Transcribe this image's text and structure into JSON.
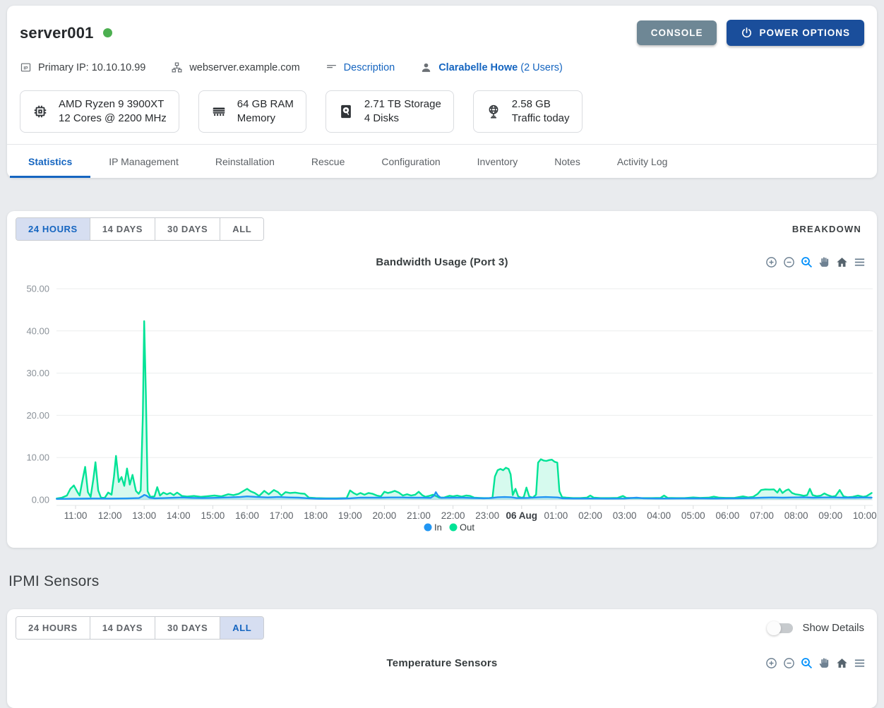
{
  "header": {
    "title": "server001",
    "status": "online",
    "console_label": "CONSOLE",
    "power_label": "POWER OPTIONS",
    "info": {
      "primary_ip": "Primary IP: 10.10.10.99",
      "hostname": "webserver.example.com",
      "description_link": "Description",
      "owner": "Clarabelle Howe",
      "owner_users": "(2 Users)"
    },
    "specs": [
      {
        "icon": "cpu-icon",
        "line1": "AMD Ryzen 9 3900XT",
        "line2": "12 Cores @ 2200 MHz"
      },
      {
        "icon": "ram-icon",
        "line1": "64 GB RAM",
        "line2": "Memory"
      },
      {
        "icon": "disk-icon",
        "line1": "2.71 TB Storage",
        "line2": "4 Disks"
      },
      {
        "icon": "traffic-icon",
        "line1": "2.58 GB",
        "line2": "Traffic today"
      }
    ],
    "tabs": [
      "Statistics",
      "IP Management",
      "Reinstallation",
      "Rescue",
      "Configuration",
      "Inventory",
      "Notes",
      "Activity Log"
    ],
    "active_tab": "Statistics"
  },
  "time_ranges": [
    "24 HOURS",
    "14 DAYS",
    "30 DAYS",
    "ALL"
  ],
  "bandwidth_section": {
    "active_range": "24 HOURS",
    "breakdown_label": "BREAKDOWN",
    "toolbar_icons": [
      "zoom-in-icon",
      "zoom-out-icon",
      "selection-zoom-icon",
      "pan-icon",
      "home-icon",
      "menu-icon"
    ]
  },
  "ipmi": {
    "heading": "IPMI Sensors",
    "active_range": "ALL",
    "show_details_label": "Show Details",
    "chart_title": "Temperature Sensors",
    "toolbar_icons": [
      "zoom-in-icon",
      "zoom-out-icon",
      "selection-zoom-icon",
      "pan-icon",
      "home-icon",
      "menu-icon"
    ]
  },
  "colors": {
    "accent_blue": "#1565c0",
    "power_button": "#1a4e9b",
    "console_button": "#6e8795",
    "status_green": "#4caf50",
    "series_in": "#2196F3",
    "series_out": "#00E396",
    "toolbar_gray": "#6E8192",
    "selection_zoom_blue": "#008FFB"
  },
  "chart_data": {
    "type": "area",
    "title": "Bandwidth Usage (Port 3)",
    "ylim": [
      0,
      50
    ],
    "y_ticks": [
      "0.00",
      "10.00",
      "20.00",
      "30.00",
      "40.00",
      "50.00"
    ],
    "x_tick_labels": [
      "11:00",
      "12:00",
      "13:00",
      "14:00",
      "15:00",
      "16:00",
      "17:00",
      "18:00",
      "19:00",
      "20:00",
      "21:00",
      "22:00",
      "23:00",
      "06 Aug",
      "01:00",
      "02:00",
      "03:00",
      "04:00",
      "05:00",
      "06:00",
      "07:00",
      "08:00",
      "09:00",
      "10:00"
    ],
    "x_range": [
      10.45,
      34.2
    ],
    "grid": "horizontal",
    "legend_position": "bottom",
    "legend": [
      "In",
      "Out"
    ],
    "series": [
      {
        "name": "In",
        "color": "#2196F3",
        "points": [
          [
            10.45,
            0.2
          ],
          [
            11.0,
            0.25
          ],
          [
            11.5,
            0.3
          ],
          [
            12.0,
            0.28
          ],
          [
            12.5,
            0.32
          ],
          [
            12.85,
            0.4
          ],
          [
            12.96,
            0.9
          ],
          [
            13.0,
            1.15
          ],
          [
            13.06,
            1.0
          ],
          [
            13.15,
            0.5
          ],
          [
            13.3,
            0.35
          ],
          [
            13.6,
            0.4
          ],
          [
            13.9,
            0.5
          ],
          [
            14.1,
            0.55
          ],
          [
            14.4,
            0.45
          ],
          [
            14.7,
            0.4
          ],
          [
            15.0,
            0.45
          ],
          [
            15.4,
            0.55
          ],
          [
            15.8,
            0.65
          ],
          [
            16.0,
            0.8
          ],
          [
            16.3,
            0.65
          ],
          [
            16.6,
            0.55
          ],
          [
            16.9,
            0.65
          ],
          [
            17.2,
            0.55
          ],
          [
            17.5,
            0.5
          ],
          [
            17.8,
            0.35
          ],
          [
            18.1,
            0.25
          ],
          [
            18.6,
            0.25
          ],
          [
            19.0,
            0.35
          ],
          [
            19.3,
            0.5
          ],
          [
            19.6,
            0.5
          ],
          [
            19.9,
            0.5
          ],
          [
            20.2,
            0.55
          ],
          [
            20.5,
            0.55
          ],
          [
            20.8,
            0.5
          ],
          [
            21.1,
            0.5
          ],
          [
            21.35,
            0.45
          ],
          [
            21.45,
            1.0
          ],
          [
            21.5,
            1.8
          ],
          [
            21.56,
            1.0
          ],
          [
            21.65,
            0.45
          ],
          [
            22.0,
            0.5
          ],
          [
            22.3,
            0.5
          ],
          [
            22.6,
            0.4
          ],
          [
            22.9,
            0.35
          ],
          [
            23.1,
            0.4
          ],
          [
            23.3,
            0.6
          ],
          [
            23.5,
            0.65
          ],
          [
            23.7,
            0.6
          ],
          [
            23.85,
            0.4
          ],
          [
            24.0,
            0.4
          ],
          [
            24.2,
            0.45
          ],
          [
            24.5,
            0.6
          ],
          [
            24.7,
            0.65
          ],
          [
            24.9,
            0.6
          ],
          [
            25.05,
            0.55
          ],
          [
            25.2,
            0.35
          ],
          [
            25.5,
            0.3
          ],
          [
            25.8,
            0.3
          ],
          [
            26.1,
            0.3
          ],
          [
            26.5,
            0.28
          ],
          [
            27.0,
            0.3
          ],
          [
            27.35,
            0.5
          ],
          [
            27.55,
            0.35
          ],
          [
            27.9,
            0.3
          ],
          [
            28.3,
            0.3
          ],
          [
            28.7,
            0.32
          ],
          [
            29.1,
            0.35
          ],
          [
            29.5,
            0.3
          ],
          [
            29.9,
            0.32
          ],
          [
            30.3,
            0.35
          ],
          [
            30.7,
            0.4
          ],
          [
            31.0,
            0.5
          ],
          [
            31.3,
            0.55
          ],
          [
            31.6,
            0.5
          ],
          [
            31.9,
            0.55
          ],
          [
            32.2,
            0.6
          ],
          [
            32.5,
            0.5
          ],
          [
            32.8,
            0.55
          ],
          [
            33.1,
            0.55
          ],
          [
            33.4,
            0.5
          ],
          [
            33.7,
            0.5
          ],
          [
            34.0,
            0.55
          ],
          [
            34.2,
            0.5
          ]
        ]
      },
      {
        "name": "Out",
        "color": "#00E396",
        "points": [
          [
            10.45,
            0.3
          ],
          [
            10.6,
            0.5
          ],
          [
            10.75,
            1.0
          ],
          [
            10.85,
            2.6
          ],
          [
            10.95,
            3.4
          ],
          [
            11.05,
            1.9
          ],
          [
            11.12,
            1.0
          ],
          [
            11.2,
            4.5
          ],
          [
            11.28,
            7.8
          ],
          [
            11.36,
            1.8
          ],
          [
            11.44,
            0.7
          ],
          [
            11.52,
            5.0
          ],
          [
            11.58,
            8.9
          ],
          [
            11.66,
            2.2
          ],
          [
            11.74,
            0.5
          ],
          [
            11.85,
            0.45
          ],
          [
            11.95,
            1.7
          ],
          [
            12.05,
            1.2
          ],
          [
            12.12,
            5.5
          ],
          [
            12.18,
            10.4
          ],
          [
            12.26,
            4.2
          ],
          [
            12.34,
            5.4
          ],
          [
            12.42,
            3.3
          ],
          [
            12.5,
            7.4
          ],
          [
            12.58,
            3.6
          ],
          [
            12.66,
            5.9
          ],
          [
            12.76,
            2.1
          ],
          [
            12.84,
            1.4
          ],
          [
            12.9,
            2.2
          ],
          [
            12.96,
            20.0
          ],
          [
            13.0,
            42.3
          ],
          [
            13.05,
            25.0
          ],
          [
            13.1,
            2.0
          ],
          [
            13.18,
            0.7
          ],
          [
            13.3,
            0.8
          ],
          [
            13.38,
            3.0
          ],
          [
            13.46,
            1.0
          ],
          [
            13.56,
            1.7
          ],
          [
            13.66,
            1.3
          ],
          [
            13.76,
            1.6
          ],
          [
            13.86,
            1.1
          ],
          [
            13.96,
            1.7
          ],
          [
            14.1,
            0.9
          ],
          [
            14.25,
            0.75
          ],
          [
            14.45,
            0.9
          ],
          [
            14.65,
            0.7
          ],
          [
            14.85,
            0.85
          ],
          [
            15.05,
            1.0
          ],
          [
            15.25,
            0.8
          ],
          [
            15.45,
            1.3
          ],
          [
            15.6,
            1.1
          ],
          [
            15.75,
            1.4
          ],
          [
            15.9,
            2.1
          ],
          [
            16.0,
            2.6
          ],
          [
            16.1,
            2.0
          ],
          [
            16.22,
            1.6
          ],
          [
            16.35,
            0.9
          ],
          [
            16.5,
            2.1
          ],
          [
            16.63,
            1.3
          ],
          [
            16.78,
            2.3
          ],
          [
            16.9,
            1.8
          ],
          [
            17.0,
            1.0
          ],
          [
            17.12,
            1.8
          ],
          [
            17.25,
            1.6
          ],
          [
            17.4,
            1.7
          ],
          [
            17.55,
            1.5
          ],
          [
            17.68,
            1.4
          ],
          [
            17.8,
            0.5
          ],
          [
            18.0,
            0.4
          ],
          [
            18.3,
            0.35
          ],
          [
            18.6,
            0.35
          ],
          [
            18.9,
            0.4
          ],
          [
            19.0,
            2.2
          ],
          [
            19.1,
            1.6
          ],
          [
            19.2,
            1.2
          ],
          [
            19.3,
            1.6
          ],
          [
            19.42,
            1.2
          ],
          [
            19.54,
            1.6
          ],
          [
            19.66,
            1.4
          ],
          [
            19.78,
            1.0
          ],
          [
            19.9,
            0.8
          ],
          [
            20.0,
            1.9
          ],
          [
            20.1,
            1.6
          ],
          [
            20.2,
            1.8
          ],
          [
            20.3,
            2.1
          ],
          [
            20.42,
            1.7
          ],
          [
            20.54,
            1.0
          ],
          [
            20.66,
            1.3
          ],
          [
            20.78,
            1.0
          ],
          [
            20.9,
            1.2
          ],
          [
            21.0,
            1.9
          ],
          [
            21.1,
            1.1
          ],
          [
            21.2,
            0.7
          ],
          [
            21.3,
            0.9
          ],
          [
            21.42,
            1.2
          ],
          [
            21.5,
            0.9
          ],
          [
            21.6,
            0.5
          ],
          [
            21.75,
            0.55
          ],
          [
            21.9,
            0.95
          ],
          [
            22.0,
            0.8
          ],
          [
            22.12,
            1.0
          ],
          [
            22.25,
            0.75
          ],
          [
            22.38,
            1.0
          ],
          [
            22.5,
            0.9
          ],
          [
            22.62,
            0.5
          ],
          [
            22.75,
            0.45
          ],
          [
            22.9,
            0.4
          ],
          [
            23.05,
            0.4
          ],
          [
            23.15,
            0.5
          ],
          [
            23.22,
            5.5
          ],
          [
            23.3,
            7.0
          ],
          [
            23.38,
            7.3
          ],
          [
            23.46,
            7.0
          ],
          [
            23.54,
            7.6
          ],
          [
            23.62,
            7.3
          ],
          [
            23.68,
            6.0
          ],
          [
            23.74,
            1.1
          ],
          [
            23.82,
            2.6
          ],
          [
            23.9,
            0.8
          ],
          [
            23.98,
            0.5
          ],
          [
            24.06,
            0.6
          ],
          [
            24.14,
            2.9
          ],
          [
            24.22,
            0.8
          ],
          [
            24.32,
            0.5
          ],
          [
            24.42,
            1.2
          ],
          [
            24.48,
            8.8
          ],
          [
            24.56,
            9.6
          ],
          [
            24.64,
            9.3
          ],
          [
            24.72,
            9.2
          ],
          [
            24.8,
            9.4
          ],
          [
            24.88,
            9.5
          ],
          [
            24.96,
            9.0
          ],
          [
            25.04,
            8.8
          ],
          [
            25.1,
            2.0
          ],
          [
            25.18,
            0.6
          ],
          [
            25.3,
            0.5
          ],
          [
            25.5,
            0.4
          ],
          [
            25.7,
            0.4
          ],
          [
            25.9,
            0.5
          ],
          [
            26.0,
            1.0
          ],
          [
            26.1,
            0.5
          ],
          [
            26.3,
            0.4
          ],
          [
            26.55,
            0.4
          ],
          [
            26.8,
            0.45
          ],
          [
            26.95,
            0.9
          ],
          [
            27.05,
            0.45
          ],
          [
            27.3,
            0.4
          ],
          [
            27.55,
            0.4
          ],
          [
            27.8,
            0.4
          ],
          [
            28.05,
            0.45
          ],
          [
            28.15,
            1.0
          ],
          [
            28.25,
            0.45
          ],
          [
            28.5,
            0.4
          ],
          [
            28.75,
            0.4
          ],
          [
            29.0,
            0.55
          ],
          [
            29.2,
            0.45
          ],
          [
            29.45,
            0.5
          ],
          [
            29.6,
            0.75
          ],
          [
            29.75,
            0.5
          ],
          [
            29.95,
            0.45
          ],
          [
            30.2,
            0.45
          ],
          [
            30.45,
            0.8
          ],
          [
            30.6,
            0.55
          ],
          [
            30.75,
            0.7
          ],
          [
            30.88,
            1.4
          ],
          [
            30.98,
            2.3
          ],
          [
            31.1,
            2.45
          ],
          [
            31.22,
            2.4
          ],
          [
            31.35,
            2.45
          ],
          [
            31.45,
            1.7
          ],
          [
            31.52,
            2.6
          ],
          [
            31.6,
            1.6
          ],
          [
            31.7,
            2.2
          ],
          [
            31.78,
            2.45
          ],
          [
            31.88,
            1.6
          ],
          [
            31.98,
            1.3
          ],
          [
            32.1,
            1.15
          ],
          [
            32.22,
            0.95
          ],
          [
            32.32,
            1.1
          ],
          [
            32.4,
            2.6
          ],
          [
            32.48,
            1.1
          ],
          [
            32.6,
            0.85
          ],
          [
            32.72,
            1.0
          ],
          [
            32.82,
            1.5
          ],
          [
            32.92,
            1.1
          ],
          [
            33.05,
            0.75
          ],
          [
            33.15,
            0.9
          ],
          [
            33.27,
            2.3
          ],
          [
            33.38,
            0.8
          ],
          [
            33.5,
            0.6
          ],
          [
            33.65,
            0.7
          ],
          [
            33.8,
            1.0
          ],
          [
            33.95,
            0.7
          ],
          [
            34.05,
            0.85
          ],
          [
            34.2,
            1.6
          ]
        ]
      }
    ]
  }
}
